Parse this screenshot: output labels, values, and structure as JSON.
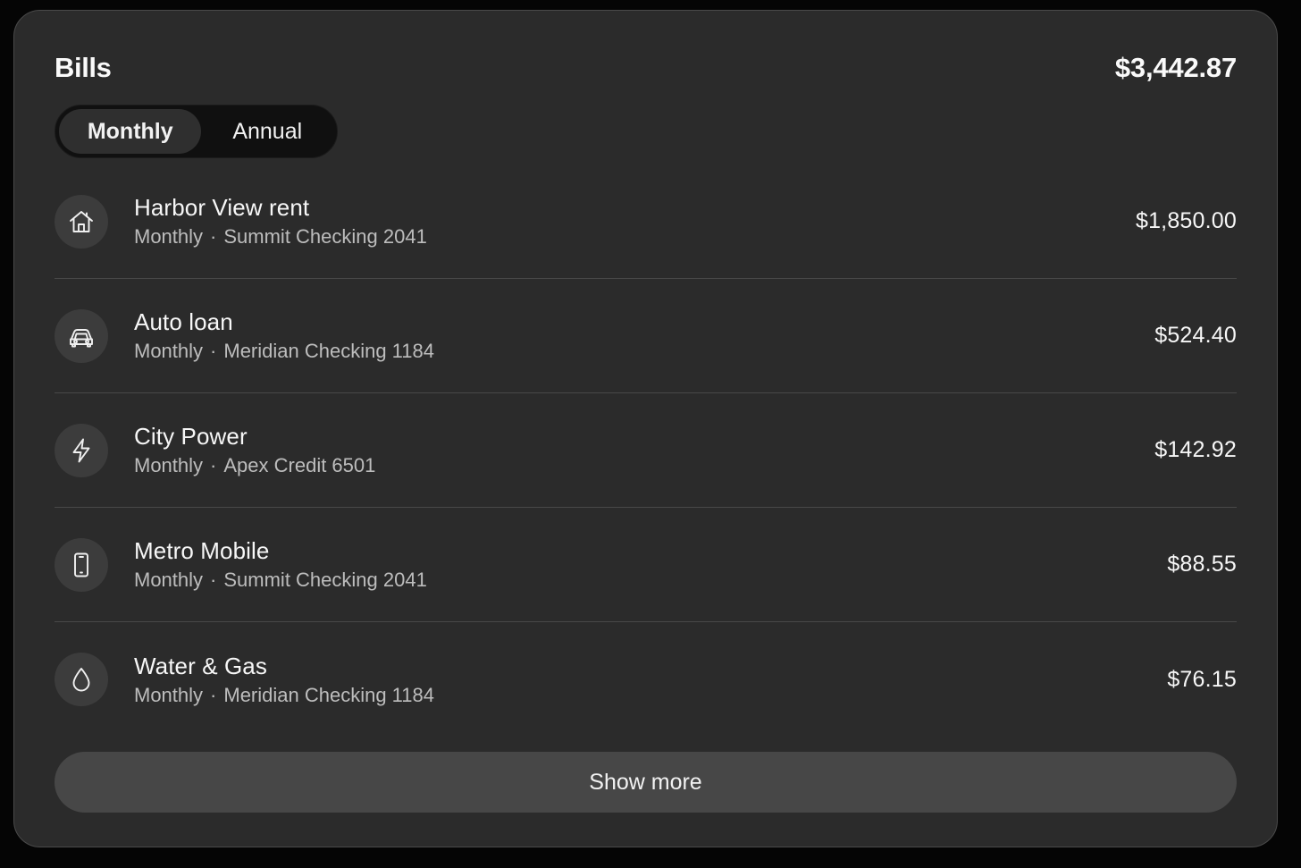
{
  "card": {
    "title": "Bills",
    "total": "$3,442.87"
  },
  "toggle": {
    "options": [
      "Monthly",
      "Annual"
    ],
    "selected": "Monthly"
  },
  "bills": [
    {
      "icon": "house-icon",
      "name": "Harbor View rent",
      "frequency": "Monthly",
      "account": "Summit Checking 2041",
      "amount": "$1,850.00"
    },
    {
      "icon": "car-icon",
      "name": "Auto loan",
      "frequency": "Monthly",
      "account": "Meridian Checking 1184",
      "amount": "$524.40"
    },
    {
      "icon": "lightning-icon",
      "name": "City Power",
      "frequency": "Monthly",
      "account": "Apex Credit 6501",
      "amount": "$142.92"
    },
    {
      "icon": "phone-icon",
      "name": "Metro Mobile",
      "frequency": "Monthly",
      "account": "Summit Checking 2041",
      "amount": "$88.55"
    },
    {
      "icon": "water-drop-icon",
      "name": "Water & Gas",
      "frequency": "Monthly",
      "account": "Meridian Checking 1184",
      "amount": "$76.15"
    }
  ],
  "separator": "·",
  "show_more_label": "Show more",
  "colors": {
    "background": "#050505",
    "card": "#2b2b2b",
    "icon_circle": "#3c3c3c",
    "toggle_track": "#101010",
    "toggle_active": "#2f2f2f",
    "button": "#474747"
  }
}
